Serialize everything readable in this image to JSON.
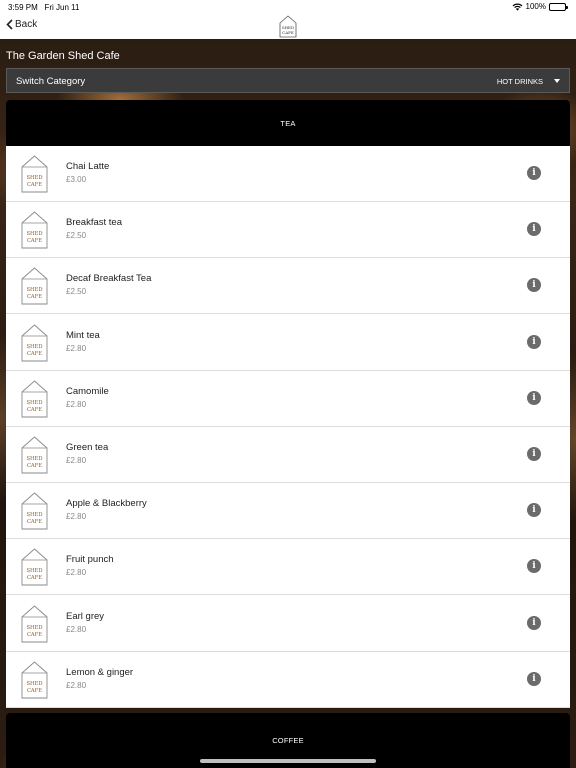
{
  "status_bar": {
    "time": "3:59 PM",
    "date": "Fri Jun 11",
    "battery": "100%"
  },
  "nav": {
    "back_label": "Back",
    "logo_text_top": "SHED",
    "logo_text_bottom": "CAFE"
  },
  "venue_name": "The Garden Shed Cafe",
  "category_switch": {
    "label": "Switch Category",
    "value": "HOT DRINKS"
  },
  "sections": [
    {
      "title": "TEA",
      "items": [
        {
          "name": "Chai Latte",
          "price": "£3.00"
        },
        {
          "name": "Breakfast tea",
          "price": "£2.50"
        },
        {
          "name": "Decaf Breakfast Tea",
          "price": "£2.50"
        },
        {
          "name": "Mint tea",
          "price": "£2.80"
        },
        {
          "name": "Camomile",
          "price": "£2.80"
        },
        {
          "name": "Green tea",
          "price": "£2.80"
        },
        {
          "name": "Apple & Blackberry",
          "price": "£2.80"
        },
        {
          "name": "Fruit punch",
          "price": "£2.80"
        },
        {
          "name": "Earl grey",
          "price": "£2.80"
        },
        {
          "name": "Lemon & ginger",
          "price": "£2.80"
        }
      ]
    },
    {
      "title": "COFFEE",
      "items": []
    }
  ],
  "item_logo": {
    "top": "SHED",
    "bottom": "CAFE"
  },
  "icons": {
    "back": "chevron-left-icon",
    "info": "info-icon",
    "wifi": "wifi-icon",
    "battery": "battery-icon",
    "caret": "caret-down-icon"
  },
  "colors": {
    "header_bg": "#000000",
    "switch_bg": "#3b3b3b",
    "info_icon": "#6b6b6b",
    "logo_brown": "#8a5a2b"
  }
}
